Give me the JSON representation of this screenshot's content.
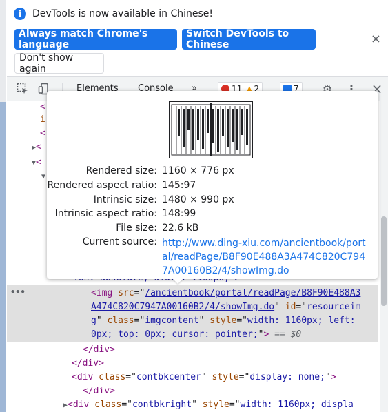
{
  "infobar": {
    "message": "DevTools is now available in Chinese!",
    "btn_match": "Always match Chrome's language",
    "btn_switch": "Switch DevTools to Chinese",
    "btn_dont_show": "Don't show again",
    "close_glyph": "×",
    "info_glyph": "i"
  },
  "toolbar": {
    "tabs": [
      "Elements",
      "Console"
    ],
    "more_glyph": "»",
    "errors": "11",
    "warnings": "2",
    "issues": "7",
    "close_glyph": "×",
    "kebab_glyph": "⋮",
    "settings_glyph": "⚙"
  },
  "tooltip": {
    "rows": [
      {
        "key": "Rendered size:",
        "value": "1160 × 776 px"
      },
      {
        "key": "Rendered aspect ratio:",
        "value": "145:97"
      },
      {
        "key": "Intrinsic size:",
        "value": "1480 × 990 px"
      },
      {
        "key": "Intrinsic aspect ratio:",
        "value": "148:99"
      },
      {
        "key": "File size:",
        "value": "22.6 kB"
      }
    ],
    "source_key": "Current source:",
    "source_url": "http://www.ding-xiu.com/ancientbook/portal/readPage/B8F90E488A3A474C820C7947A00160B2/4/showImg.do"
  },
  "code": {
    "partial_line": "ion: absolute; width: 1160px;\">",
    "img_tag_open": "<img",
    "src_attr": "src",
    "src_value": "/ancientbook/portal/readPage/B8F90E488A3A474C820C7947A00160B2/4/showImg.do",
    "id_attr": "id",
    "id_value": "resourceimg",
    "class_attr": "class",
    "class_value": "imgcontent",
    "style_attr": "style",
    "style_value": "width: 1160px; left: 0px; top: 0px; cursor: pointer;",
    "eq_dollar": "== $0",
    "close_div": "</div>",
    "div_center": "<div class=\"contbkcenter\" style=\"display: none;\">",
    "div_right": "<div class=\"contbkright\" style=\"width: 1160px; displa",
    "dots": "•••"
  },
  "colors": {
    "accent": "#1a73e8",
    "tag": "#881280",
    "attr": "#994500",
    "value": "#1a1aa6"
  }
}
